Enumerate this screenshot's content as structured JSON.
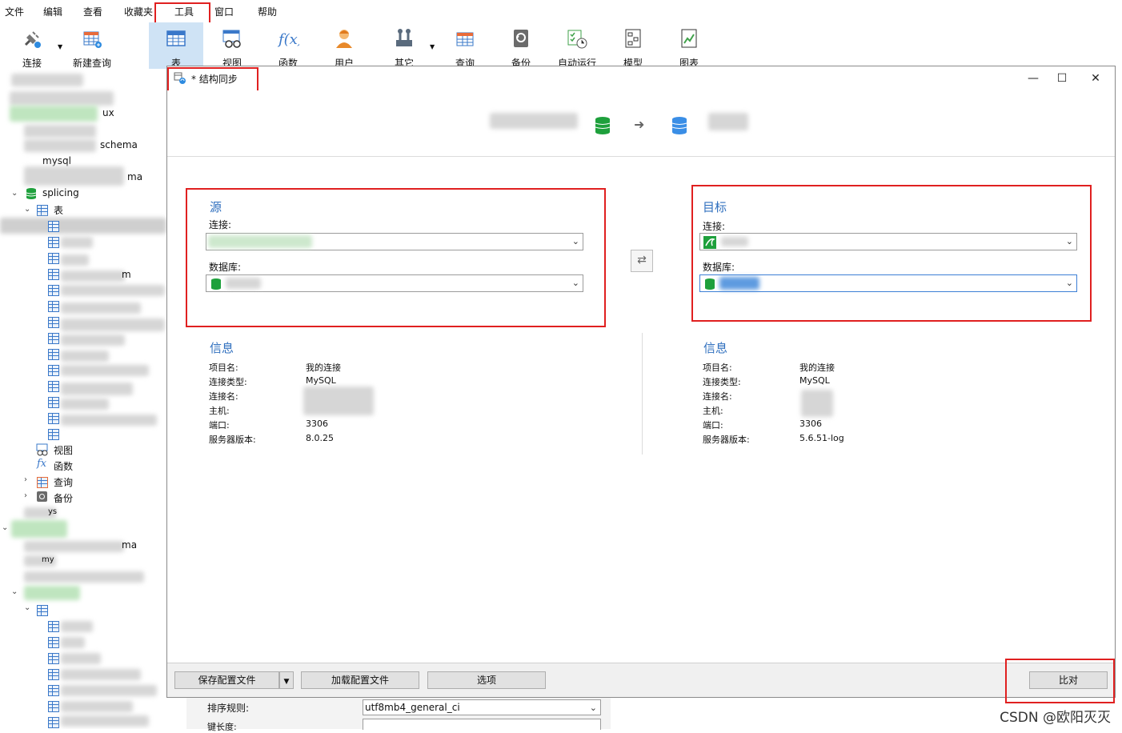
{
  "menu": [
    "文件",
    "编辑",
    "查看",
    "收藏夹",
    "工具",
    "窗口",
    "帮助"
  ],
  "toolbar": {
    "items": [
      {
        "label": "连接",
        "icon": "plug-icon"
      },
      {
        "label": "新建查询",
        "icon": "new-query-icon"
      },
      {
        "label": "表",
        "icon": "table-icon"
      },
      {
        "label": "视图",
        "icon": "view-icon"
      },
      {
        "label": "函数",
        "icon": "function-icon"
      },
      {
        "label": "用户",
        "icon": "user-icon"
      },
      {
        "label": "其它",
        "icon": "tools-icon"
      },
      {
        "label": "查询",
        "icon": "query-icon"
      },
      {
        "label": "备份",
        "icon": "backup-icon"
      },
      {
        "label": "自动运行",
        "icon": "schedule-icon"
      },
      {
        "label": "模型",
        "icon": "model-icon"
      },
      {
        "label": "图表",
        "icon": "chart-icon"
      }
    ]
  },
  "tree": {
    "nodes": [
      "ux",
      "schema",
      "mysql",
      "ma",
      "splicing",
      "表",
      "m",
      "视图",
      "函数",
      "查询",
      "备份",
      "ys",
      "ma",
      "my"
    ]
  },
  "dialog": {
    "title": "* 结构同步",
    "controls": {
      "minimize": "—",
      "maximize": "☐",
      "close": "✕"
    },
    "source": {
      "title": "源",
      "connection_label": "连接:",
      "database_label": "数据库:",
      "info_title": "信息",
      "info": [
        {
          "k": "项目名:",
          "v": "我的连接"
        },
        {
          "k": "连接类型:",
          "v": "MySQL"
        },
        {
          "k": "连接名:",
          "v": ""
        },
        {
          "k": "主机:",
          "v": ""
        },
        {
          "k": "端口:",
          "v": "3306"
        },
        {
          "k": "服务器版本:",
          "v": "8.0.25"
        }
      ]
    },
    "target": {
      "title": "目标",
      "connection_label": "连接:",
      "database_label": "数据库:",
      "info_title": "信息",
      "info": [
        {
          "k": "项目名:",
          "v": "我的连接"
        },
        {
          "k": "连接类型:",
          "v": "MySQL"
        },
        {
          "k": "连接名:",
          "v": ""
        },
        {
          "k": "主机:",
          "v": ""
        },
        {
          "k": "端口:",
          "v": "3306"
        },
        {
          "k": "服务器版本:",
          "v": "5.6.51-log"
        }
      ]
    },
    "footer": {
      "save_config": "保存配置文件",
      "load_config": "加载配置文件",
      "options": "选项",
      "compare": "比对"
    }
  },
  "background_form": {
    "collation_label": "排序规则:",
    "collation_value": "utf8mb4_general_ci",
    "next_label": "键长度:"
  },
  "watermark": "CSDN @欧阳灭灭",
  "colors": {
    "accent": "#2f6fbe",
    "highlight": "#e02020",
    "db_green": "#1ea03c",
    "db_blue": "#3a8ee6"
  }
}
